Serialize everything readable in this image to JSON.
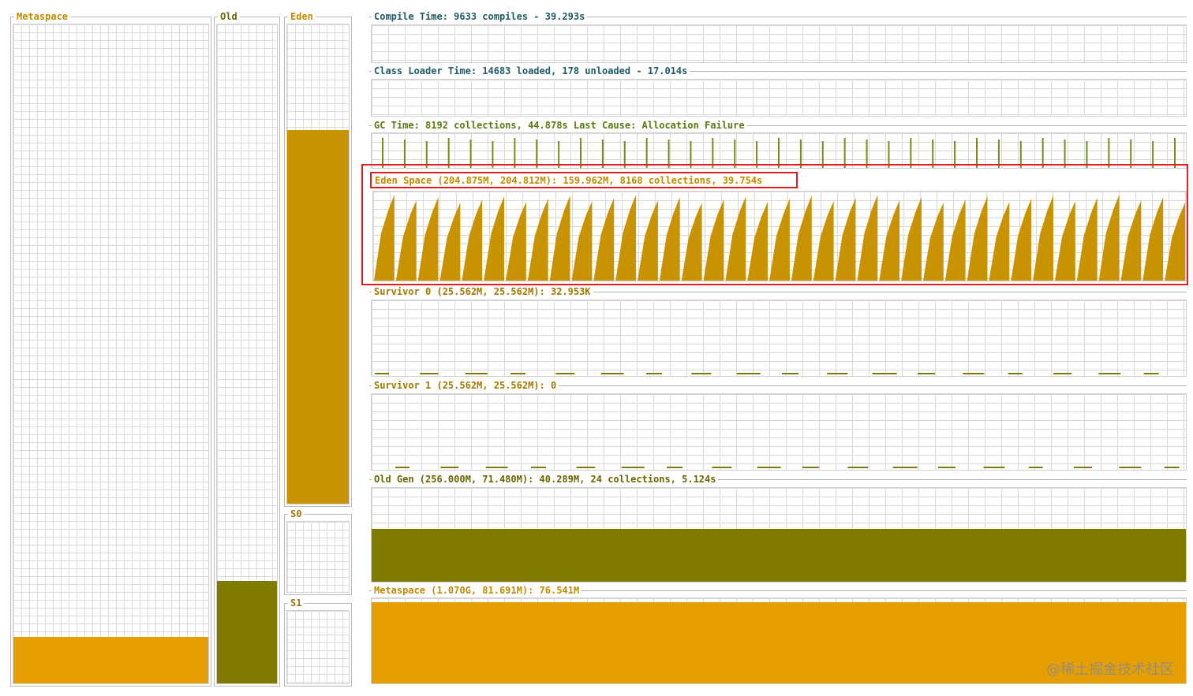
{
  "colors": {
    "orange": "#e69f00",
    "eden": "#c99300",
    "olive": "#807a00",
    "gc_spike": "#6f8f1a",
    "title_orange": "#c38a00",
    "title_teal": "#1f5b66",
    "highlight": "#e02020"
  },
  "left_panels": {
    "metaspace": {
      "label": "Metaspace",
      "fill_fraction": 0.07
    },
    "old": {
      "label": "Old",
      "fill_fraction": 0.155
    },
    "eden": {
      "label": "Eden",
      "fill_fraction": 0.78
    },
    "s0": {
      "label": "S0",
      "fill_fraction": 0.0
    },
    "s1": {
      "label": "S1",
      "fill_fraction": 0.0
    }
  },
  "graphs": {
    "compile": {
      "title": "Compile Time: 9633 compiles - 39.293s"
    },
    "classloader": {
      "title": "Class Loader Time: 14683 loaded, 178 unloaded - 17.014s"
    },
    "gc": {
      "title": "GC Time: 8192 collections, 44.878s  Last Cause: Allocation Failure",
      "spike_count": 37
    },
    "eden": {
      "title": "Eden Space (204.875M, 204.812M): 159.962M, 8168 collections, 39.754s",
      "sawtooth_count": 37
    },
    "survivor0": {
      "title": "Survivor 0 (25.562M, 25.562M): 32.953K"
    },
    "survivor1": {
      "title": "Survivor 1 (25.562M, 25.562M): 0"
    },
    "oldgen": {
      "title": "Old Gen (256.000M, 71.480M): 40.289M, 24 collections, 5.124s",
      "fill_fraction": 0.56
    },
    "metaspace": {
      "title": "Metaspace (1.070G, 81.691M): 76.541M",
      "fill_fraction": 0.95
    }
  },
  "watermark": "@稀土掘金技术社区"
}
